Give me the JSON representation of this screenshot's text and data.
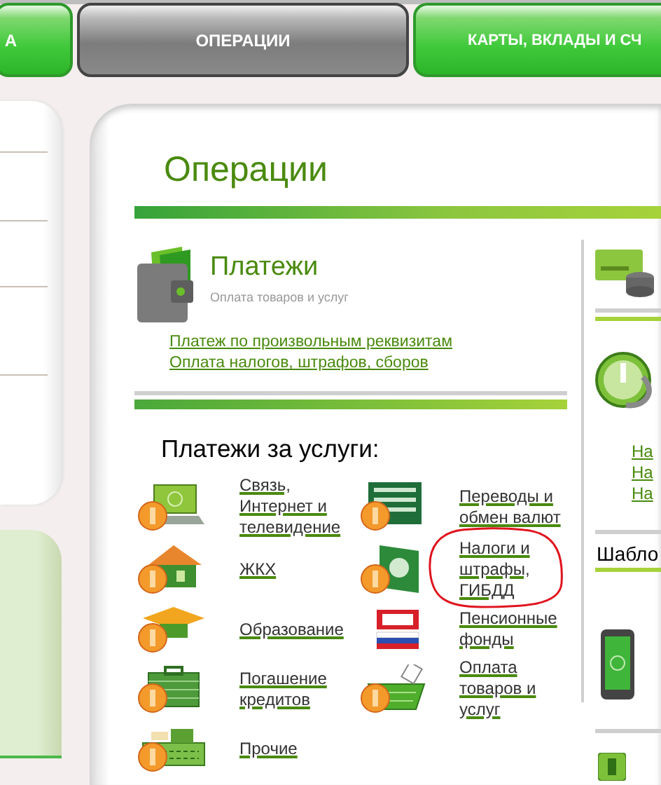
{
  "tabs": [
    {
      "label": "А",
      "selected": false
    },
    {
      "label": "ОПЕРАЦИИ",
      "selected": true
    },
    {
      "label": "КАРТЫ, ВКЛАДЫ И СЧ",
      "selected": false
    }
  ],
  "page_title": "Операции",
  "payments": {
    "title": "Платежи",
    "subtitle": "Оплата товаров и услуг",
    "links": [
      "Платеж по произвольным реквизитам",
      "Оплата налогов, штрафов, сборов"
    ]
  },
  "services": {
    "heading": "Платежи за услуги:",
    "items": [
      {
        "label": "Связь, Интернет и телевидение",
        "highlighted": false
      },
      {
        "label": "Переводы и обмен валют",
        "highlighted": false
      },
      {
        "label": "ЖКХ",
        "highlighted": false
      },
      {
        "label": "Налоги и штрафы, ГИБДД",
        "highlighted": true
      },
      {
        "label": "Образование",
        "highlighted": false
      },
      {
        "label": "Пенсионные фонды",
        "highlighted": false
      },
      {
        "label": "Погашение кредитов",
        "highlighted": false
      },
      {
        "label": "Оплата товаров и услуг",
        "highlighted": false
      },
      {
        "label": "Прочие",
        "highlighted": false
      }
    ]
  },
  "right_column": {
    "links": [
      "На",
      "На",
      "На"
    ],
    "templates_heading": "Шабло"
  }
}
